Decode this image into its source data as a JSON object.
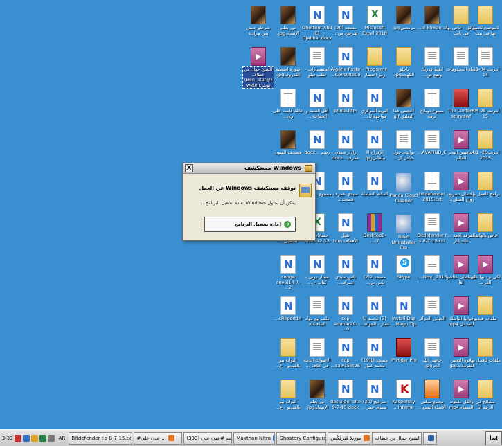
{
  "desktop_icons": [
    {
      "label": "شرطو جيش بص مرادبة",
      "type": "img"
    },
    {
      "label": "نور يعلم الإنسانjpg.",
      "type": "img"
    },
    {
      "label": "Ghettout Abd El Djabbar.docx",
      "type": "word"
    },
    {
      "label": "مسجد (20) تفرعيح س...",
      "type": "word"
    },
    {
      "label": "Microsoft Excel 2010",
      "type": "excel"
    },
    {
      "label": "مرمصيjpg.",
      "type": "img"
    },
    {
      "label": "al-khwan-al...",
      "type": "img"
    },
    {
      "label": "وثائق - خاص بها في ثابت",
      "type": "folder"
    },
    {
      "label": "1موضيع للعمل بها في ثبت",
      "type": "folder"
    },
    {
      "label": "الشيخ جهال بن عطاف (@Ben_ataf) تويتر.webm",
      "type": "video",
      "selected": true
    },
    {
      "label": "صورة اصطية القدروفjpg.",
      "type": "img"
    },
    {
      "label": "استفسارات - طلب فيلو",
      "type": "doc"
    },
    {
      "label": "Algérie Poste Consultatio...",
      "type": "word"
    },
    {
      "label": "Programs - رمز احتصار",
      "type": "folder"
    },
    {
      "label": "باحلق الكهجةjpg.",
      "type": "folder"
    },
    {
      "label": "أبقط قدرتك وضع ص...",
      "type": "doc"
    },
    {
      "label": "سلة المحذوفات",
      "type": "doc"
    },
    {
      "label": "أنترنت 04-11-14",
      "type": "doc"
    },
    {
      "label": "عائلة قامت على وي...",
      "type": "doc"
    },
    {
      "label": "أهل السنة و الجماعة ...",
      "type": "word"
    },
    {
      "label": "photo.htm",
      "type": "word"
    },
    {
      "label": "البريد المركزي مواجهه لل...",
      "type": "word"
    },
    {
      "label": "أعجبني هذا التعليق.gif",
      "type": "img"
    },
    {
      "label": "ممنوع دوبلاج ترمة",
      "type": "doc"
    },
    {
      "label": "The Lantern story.swf",
      "type": "red"
    },
    {
      "label": "أنترنت 28-04-15",
      "type": "folder"
    },
    {
      "label": "مصحف الفنون",
      "type": "img"
    },
    {
      "label": "رسم ...docx",
      "type": "word"
    },
    {
      "label": "رادار سيدي عمرف...docx",
      "type": "word"
    },
    {
      "label": "الإفراج الا بيلقانيjpg.",
      "type": "word"
    },
    {
      "label": "بوالدي حول حياتي ال...",
      "type": "doc"
    },
    {
      "label": "AVAFIND_E...",
      "type": "doc"
    },
    {
      "label": "أنتاقيس البحر العالم",
      "type": "video"
    },
    {
      "label": "أنترنت28- 01-2015",
      "type": "folder"
    },
    {
      "label": "مستوي...docx",
      "type": "word"
    },
    {
      "label": "سيدي عمرف مسجد...",
      "type": "word"
    },
    {
      "label": "المكنة الشاملة",
      "type": "word"
    },
    {
      "label": "Panda Cloud Cleaner",
      "type": "app"
    },
    {
      "label": "bitdefender 2015.txt",
      "type": "doc"
    },
    {
      "label": "احتفال تشريع زواج المثلي...",
      "type": "video"
    },
    {
      "label": "برامج للعمل بها",
      "type": "folder"
    },
    {
      "label": "فنملك العدد الجميل ...",
      "type": "doc"
    },
    {
      "label": "حسابات 10 13-12-.xlsx",
      "type": "excel"
    },
    {
      "label": "تفيل الأقفاف.htm",
      "type": "word"
    },
    {
      "label": "Desktop8-7-...",
      "type": "rar"
    },
    {
      "label": "Revo Uninstaller Pro",
      "type": "app"
    },
    {
      "label": "Bitdefender t s 8-7-15.txt",
      "type": "doc"
    },
    {
      "label": "الفرقد الأمة ... عائد اثار",
      "type": "video"
    },
    {
      "label": "خاص بالهاتف",
      "type": "folder"
    },
    {
      "label": "congé envoi14-7-2...",
      "type": "word"
    },
    {
      "label": "سيبار دوني - كتاب ع ...",
      "type": "word"
    },
    {
      "label": "ناس سيدي عمرف...",
      "type": "word"
    },
    {
      "label": "مسجد 2(2) ناس س...",
      "type": "word"
    },
    {
      "label": "Skype",
      "type": "skype"
    },
    {
      "label": "Nmc_2015-...",
      "type": "doc"
    },
    {
      "label": "السلطان عثاشو اها",
      "type": "video"
    },
    {
      "label": "لكي نزد بها على الغرب",
      "type": "video"
    },
    {
      "label": "cReport14...",
      "type": "word"
    },
    {
      "label": "ملف بيع مواد البناء.xls",
      "type": "doc"
    },
    {
      "label": "ccp ammar29-0...",
      "type": "word"
    },
    {
      "label": "(3) محمد أيا عمار - الجوائد...",
      "type": "word"
    },
    {
      "label": "Install Das Magn Tip...",
      "type": "word"
    },
    {
      "label": "الجيش الجزائر",
      "type": "doc"
    },
    {
      "label": "قوانيا الباسلة للمدخل.mp4",
      "type": "video"
    },
    {
      "label": "ملفات فيديو",
      "type": "folder"
    },
    {
      "label": "البوانة بيو بالفيديو - ع...",
      "type": "folder"
    },
    {
      "label": "الأصوات الدينة في علاقة ...",
      "type": "doc"
    },
    {
      "label": "ccp saw15et26...",
      "type": "word"
    },
    {
      "label": "مسجد أنا(19) محمد عمار",
      "type": "word"
    },
    {
      "label": "IP Hider Pro",
      "type": "red"
    },
    {
      "label": "خاصي أنك الجزjpg.",
      "type": "doc"
    },
    {
      "label": "فوة التعبير للفرملاتjpg.",
      "type": "video"
    },
    {
      "label": "ملفات للعمل بها",
      "type": "folder"
    },
    {
      "label": "البوانة بيو بالفيديو - ع...",
      "type": "folder"
    },
    {
      "label": "نور يعلم الإنسانjpg.",
      "type": "img"
    },
    {
      "label": "das alger site 9-7-15.docx",
      "type": "word"
    },
    {
      "label": "تفرعيح (20) سيدي عمر...",
      "type": "word"
    },
    {
      "label": "Kaspersky Interne...",
      "type": "k"
    },
    {
      "label": "مجمع سكني الأسلة التسع...",
      "type": "orange"
    },
    {
      "label": "والقل ملكوت السماء.mp4",
      "type": "video"
    },
    {
      "label": "مسالح في الريبة أنا",
      "type": "folder"
    }
  ],
  "dialog": {
    "title": "مستكشف Windows",
    "heading": "توقف مستكشف Windows عن العمل",
    "message": "يمكن أن يحاول Windows إعادة تشغيل البرنامج...",
    "action": "إعادة تشغيل البرنامج",
    "close_glyph": "X"
  },
  "taskbar": {
    "clock": "3:33",
    "language": "AR",
    "start_label": "ابدأ",
    "buttons": [
      "Bitdefender t s 8-7-15.txt...",
      "#عدن على ...",
      "(333) الوسم #عدن على",
      "Maxthon Nitro",
      "Ghostery Configuration",
      "موزيلا فَيَرفُكْس",
      "الشيخ جمال بن عطاف (@...",
      ""
    ]
  }
}
